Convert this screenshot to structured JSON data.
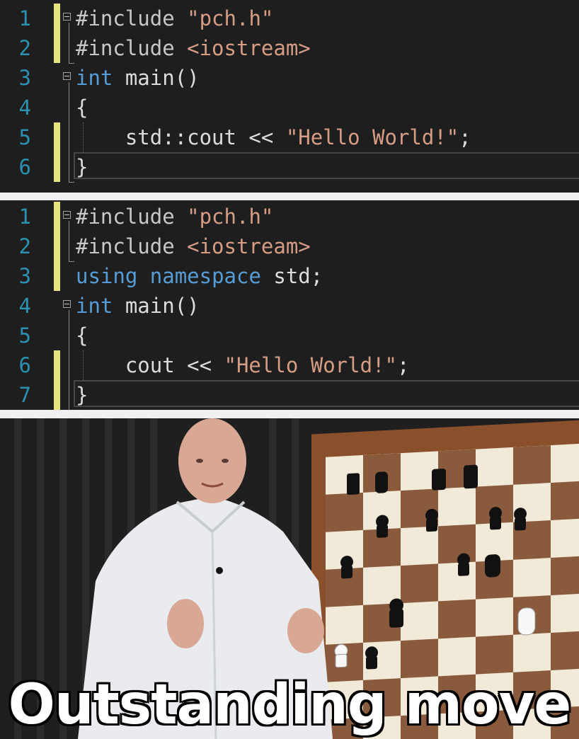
{
  "editor1": {
    "lines": [
      {
        "num": "1",
        "pre": "#include ",
        "str": "\"pch.h\"",
        "rest": ""
      },
      {
        "num": "2",
        "pre": "#include ",
        "str": "<iostream>",
        "rest": ""
      },
      {
        "num": "3",
        "kw": "int",
        "rest": " main()"
      },
      {
        "num": "4",
        "rest": "{"
      },
      {
        "num": "5",
        "lead": "    std::cout << ",
        "str": "\"Hello World!\"",
        "tail": ";"
      },
      {
        "num": "6",
        "rest": "}"
      }
    ]
  },
  "editor2": {
    "lines": [
      {
        "num": "1",
        "pre": "#include ",
        "str": "\"pch.h\""
      },
      {
        "num": "2",
        "pre": "#include ",
        "str": "<iostream>"
      },
      {
        "num": "3",
        "kw1": "using",
        "kw2": "namespace",
        "rest": " std;"
      },
      {
        "num": "4",
        "kw": "int",
        "rest": " main()"
      },
      {
        "num": "5",
        "rest": "{"
      },
      {
        "num": "6",
        "lead": "    cout << ",
        "str": "\"Hello World!\"",
        "tail": ";"
      },
      {
        "num": "7",
        "rest": "}"
      }
    ]
  },
  "caption": "Outstanding move",
  "colors": {
    "editor_bg": "#1e1e1e",
    "line_number": "#2b91af",
    "keyword": "#569cd6",
    "string": "#d69d85",
    "change_marker": "#e5e580"
  },
  "icons": [
    "fold-minus-icon"
  ]
}
